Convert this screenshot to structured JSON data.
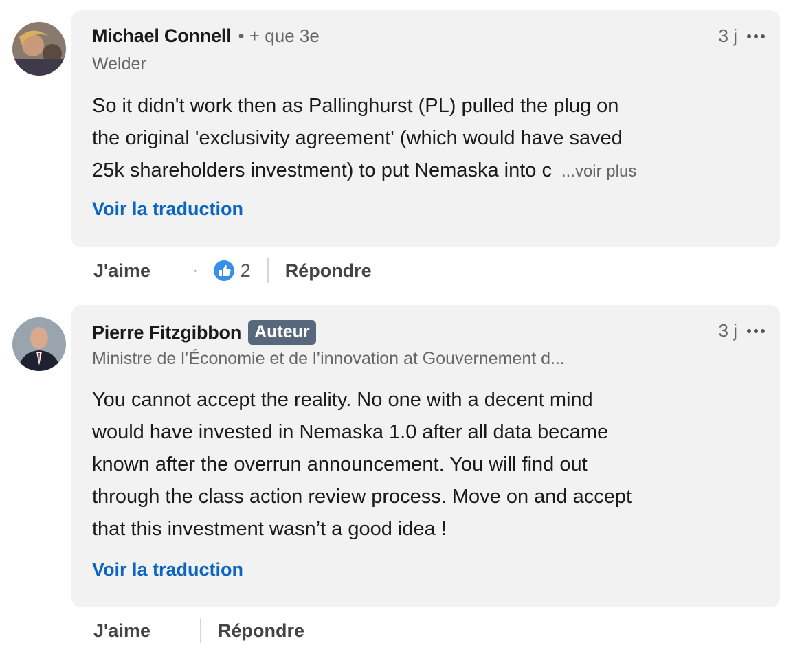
{
  "comments": [
    {
      "name": "Michael Connell",
      "degree": "• + que 3e",
      "headline": "Welder",
      "time": "3 j",
      "body_lines": [
        "So it didn't work then as Pallinghurst (PL) pulled the plug on",
        "the original 'exclusivity agreement' (which would have saved",
        "25k shareholders investment) to put Nemaska into c"
      ],
      "see_more": "...voir plus",
      "translate": "Voir la traduction",
      "like_label": "J'aime",
      "like_count": "2",
      "reply_label": "Répondre"
    },
    {
      "name": "Pierre Fitzgibbon",
      "badge": "Auteur",
      "headline": "Ministre de l’Économie et de l’innovation at Gouvernement d...",
      "time": "3 j",
      "body_lines": [
        "You cannot accept the reality. No one with a decent mind",
        "would have invested in Nemaska 1.0 after all data became",
        "known after the overrun announcement. You will find out",
        "through the class action review process. Move on and accept",
        "that this investment wasn’t a good idea !"
      ],
      "translate": "Voir la traduction",
      "like_label": "J'aime",
      "reply_label": "Répondre"
    }
  ],
  "colors": {
    "bubble": "#f2f2f2",
    "link": "#0a66c2",
    "badge": "#56687a"
  },
  "icons": [
    "more-options-icon",
    "like-reaction-icon"
  ]
}
